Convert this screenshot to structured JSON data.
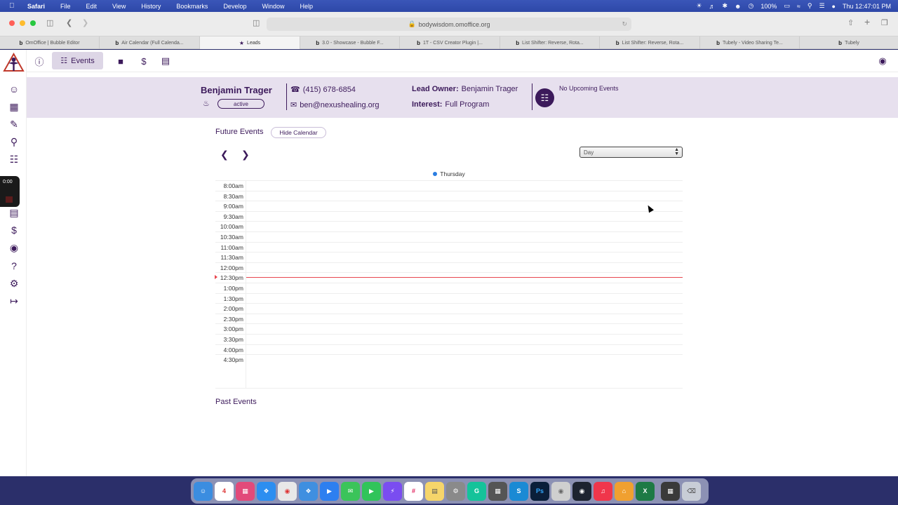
{
  "menubar": {
    "app": "Safari",
    "items": [
      "File",
      "Edit",
      "View",
      "History",
      "Bookmarks",
      "Develop",
      "Window",
      "Help"
    ],
    "battery": "100%",
    "clock": "Thu 12:47:01 PM"
  },
  "browser": {
    "url": "bodywisdom.omoffice.org",
    "tabs": [
      {
        "label": "OmOffice | Bubble Editor",
        "favicon": "b"
      },
      {
        "label": "Air Calendar (Full Calenda...",
        "favicon": "b"
      },
      {
        "label": "Leads",
        "favicon": "logo"
      },
      {
        "label": "3.0 - Showcase - Bubble F...",
        "favicon": "b"
      },
      {
        "label": "1T - CSV Creator Plugin |...",
        "favicon": "b"
      },
      {
        "label": "List Shifter: Reverse, Rota...",
        "favicon": "b"
      },
      {
        "label": "List Shifter: Reverse, Rota...",
        "favicon": "b"
      },
      {
        "label": "Tubely - Video Sharing Te...",
        "favicon": "b"
      },
      {
        "label": "Tubely",
        "favicon": "b"
      }
    ]
  },
  "recording": {
    "time": "0:00"
  },
  "topnav": {
    "events_label": "Events"
  },
  "lead": {
    "name": "Benjamin Trager",
    "status": "active",
    "phone": "(415) 678-6854",
    "email": "ben@nexushealing.org",
    "owner_label": "Lead Owner:",
    "owner": "Benjamin Trager",
    "interest_label": "Interest:",
    "interest": "Full Program",
    "upcoming": "No Upcoming Events"
  },
  "events": {
    "future_title": "Future Events",
    "hide_calendar": "Hide Calendar",
    "view": "Day",
    "day_label": "Thursday",
    "times": [
      "8:00am",
      "8:30am",
      "9:00am",
      "9:30am",
      "10:00am",
      "10:30am",
      "11:00am",
      "11:30am",
      "12:00pm",
      "12:30pm",
      "1:00pm",
      "1:30pm",
      "2:00pm",
      "2:30pm",
      "3:00pm",
      "3:30pm",
      "4:00pm",
      "4:30pm"
    ],
    "now_slot": "12:30pm",
    "past_title": "Past Events"
  },
  "colors": {
    "brand": "#3c1a5b",
    "header_bg": "#e7e0ee",
    "now_line": "#e8474f"
  }
}
